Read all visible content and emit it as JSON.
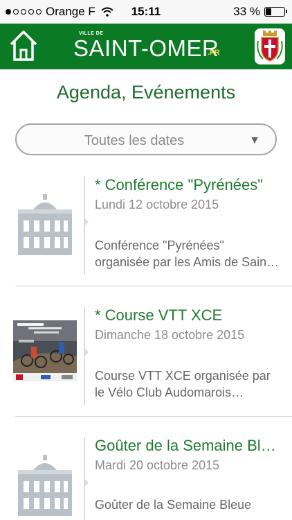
{
  "status_bar": {
    "carrier": "Orange F",
    "time": "15:11",
    "battery_percent": "33 %",
    "battery_level": 0.33,
    "signal_bars": 1
  },
  "header": {
    "ville_label": "VILLE DE",
    "logo_text": "SAINT-OMER",
    "logo_tld": ".FR",
    "home_icon": "home-icon",
    "crest_icon": "coat-of-arms-icon",
    "color": "#0b7a24"
  },
  "page": {
    "title": "Agenda, Evénements"
  },
  "date_filter": {
    "selected": "Toutes les dates",
    "arrow": "▼"
  },
  "events": [
    {
      "title": "* Conférence \"Pyrénées\"",
      "date": "Lundi 12 octobre 2015",
      "desc_line1": "Conférence \"Pyrénées\"",
      "desc_line2": "organisée par les Amis de Sain…",
      "thumbnail": "building-placeholder-icon"
    },
    {
      "title": "* Course VTT XCE",
      "date": "Dimanche 18 octobre 2015",
      "desc_line1": "Course VTT XCE organisée par",
      "desc_line2": "le Vélo Club Audomarois…",
      "thumbnail": "event-poster-photo"
    },
    {
      "title": "Goûter de la Semaine Bl…",
      "date": "Mardi 20 octobre 2015",
      "desc_line1": "Goûter de la Semaine Bleue",
      "desc_line2": "",
      "thumbnail": "building-placeholder-icon"
    }
  ]
}
